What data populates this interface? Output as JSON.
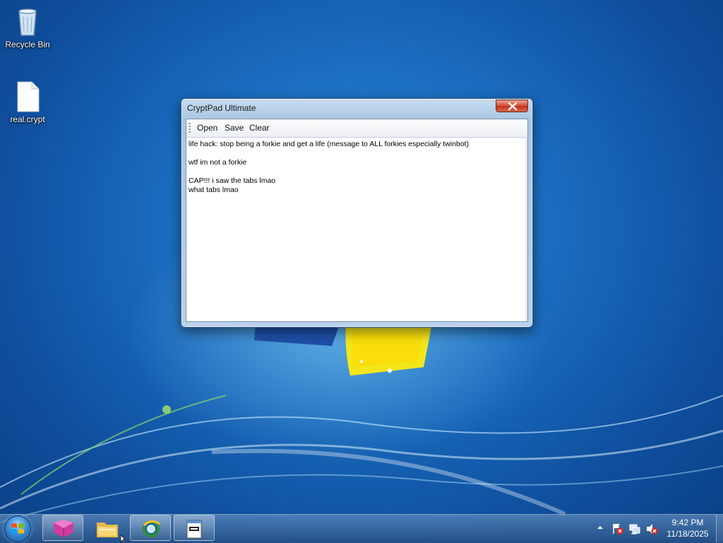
{
  "desktop": {
    "icons": [
      {
        "label": "Recycle Bin",
        "icon": "recycle-bin-icon"
      },
      {
        "label": "real.crypt",
        "icon": "file-icon"
      }
    ]
  },
  "window": {
    "title": "CryptPad Ultimate",
    "close_icon": "close-icon",
    "toolbar": {
      "open_label": "Open",
      "save_label": "Save",
      "clear_label": "Clear"
    },
    "editor_text": "life hack: stop being a forkie and get a life (message to ALL forkies especially twinbot)\n\nwtf im not a forkie\n\nCAP!!! i saw the tabs lmao\nwhat tabs lmao"
  },
  "taskbar": {
    "start_icon": "windows-start-icon",
    "pinned": [
      {
        "icon": "app-icon"
      },
      {
        "icon": "folder-icon"
      },
      {
        "icon": "browser-icon"
      },
      {
        "icon": "notepad-icon"
      }
    ],
    "tray": {
      "icons": [
        "chevron-up-icon",
        "action-center-flag-icon",
        "network-icon",
        "volume-muted-icon"
      ],
      "time": "9:42 PM",
      "date": "11/18/2025"
    }
  },
  "colors": {
    "desktop_bg": "#1a6cc0",
    "close_button": "#c2341c",
    "window_frame": "#a9c6e3"
  }
}
